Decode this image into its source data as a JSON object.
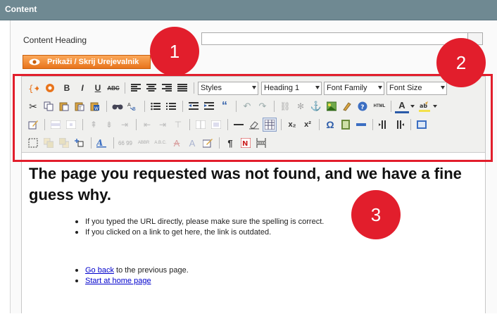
{
  "header": {
    "title": "Content"
  },
  "form": {
    "heading_label": "Content Heading",
    "heading_value": "",
    "toggle_button": "Prikaži / Skrij Urejevalnik"
  },
  "toolbar": {
    "styles_select": "Styles",
    "format_select": "Heading 1",
    "font_family_select": "Font Family",
    "font_size_select": "Font Size",
    "row1_labels": {
      "bold": "B",
      "italic": "I",
      "underline": "U",
      "strike": "ABC"
    },
    "row2_labels": {
      "html": "HTML",
      "color": "A"
    },
    "row3_labels": {
      "quote": "“"
    },
    "row4_labels": {
      "sub": "x₂",
      "sup": "x²",
      "omega": "Ω"
    },
    "row5_labels": {
      "cite": "66 99",
      "abbr": "ABBR",
      "acronym": "A.B.C.",
      "del": "A",
      "ins": "A",
      "pilcrow": "¶"
    }
  },
  "content": {
    "heading": "The page you requested was not found, and we have a fine guess why.",
    "reasons": [
      "If you typed the URL directly, please make sure the spelling is correct.",
      "If you clicked on a link to get here, the link is outdated."
    ],
    "actions": [
      {
        "link": "Go back",
        "rest": " to the previous page."
      },
      {
        "link": "Start at home page",
        "rest": ""
      }
    ]
  },
  "callouts": [
    "1",
    "2",
    "3"
  ],
  "colors": {
    "header": "#6f8992",
    "accent": "#e8741c",
    "callout": "#e21e2c",
    "link": "#0000cc"
  }
}
